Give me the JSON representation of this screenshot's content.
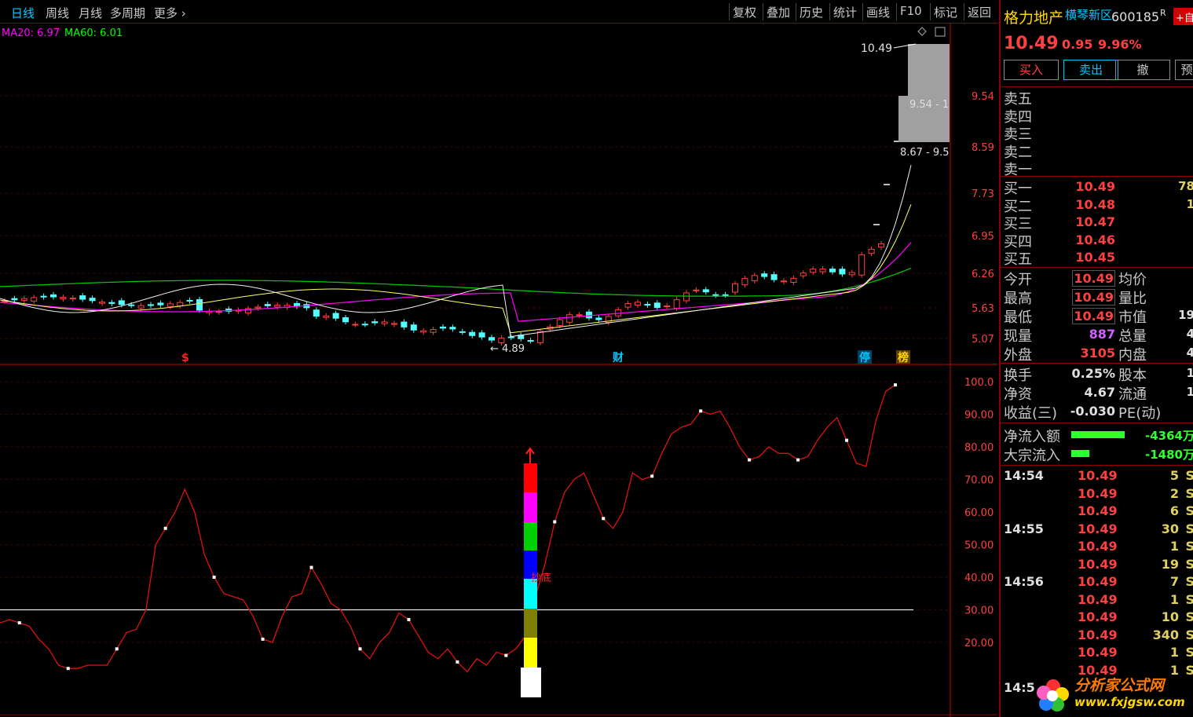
{
  "toolbar": {
    "periods": [
      "日线",
      "周线",
      "月线",
      "多周期",
      "更多"
    ],
    "buttons": [
      "复权",
      "叠加",
      "历史",
      "统计",
      "画线",
      "F10",
      "标记",
      "返回"
    ]
  },
  "main_chart": {
    "ma_legend": [
      {
        "label": "MA20: 6.97",
        "color": "#ff00ff"
      },
      {
        "label": "MA60: 6.01",
        "color": "#00ff00"
      }
    ],
    "price_axis": [
      "9.54",
      "8.59",
      "7.73",
      "6.95",
      "6.26",
      "5.63",
      "5.07"
    ],
    "top_label": "10.49",
    "chip_labels": [
      "9.54 - 1",
      "8.67 - 9.5"
    ],
    "low_label": "4.89",
    "event_markers": [
      {
        "text": "$",
        "color": "#ff2020"
      },
      {
        "text": "财",
        "color": "#00c8ff"
      },
      {
        "text": "停",
        "color": "#00c8ff"
      },
      {
        "text": "榜",
        "color": "#ffd700"
      }
    ]
  },
  "indicator": {
    "axis": [
      "100.0",
      "90.00",
      "80.00",
      "70.00",
      "60.00",
      "50.00",
      "40.00",
      "30.00",
      "20.00"
    ],
    "signal_label": "抄底"
  },
  "chart_data": {
    "type": "line",
    "title": "",
    "xlabel": "",
    "ylabel": "",
    "ylim": [
      10,
      100
    ],
    "reference_line": 30,
    "series": [
      {
        "values": [
          26,
          27,
          26,
          25,
          21,
          18,
          13,
          12,
          12,
          13,
          13,
          13,
          18,
          23,
          24,
          30,
          50,
          55,
          60,
          67,
          60,
          47,
          40,
          35,
          34,
          33,
          28,
          21,
          20,
          28,
          34,
          35,
          43,
          38,
          32,
          30,
          25,
          18,
          15,
          20,
          23,
          29,
          27,
          22,
          17,
          15,
          18,
          14,
          11,
          15,
          13,
          17,
          16,
          18,
          22,
          34,
          44,
          57,
          66,
          70,
          72,
          65,
          58,
          55,
          60,
          72,
          70,
          71,
          78,
          84,
          86,
          87,
          91,
          90,
          91,
          86,
          80,
          76,
          77,
          80,
          78,
          78,
          76,
          77,
          82,
          86,
          89,
          82,
          75,
          74,
          88,
          97,
          99
        ]
      }
    ]
  },
  "quote": {
    "name": "格力地产",
    "tag": "横琴新区",
    "code": "600185",
    "r_mark": "R",
    "add_label": "+自",
    "price": "10.49",
    "change": "0.95",
    "change_pct": "9.96%",
    "buttons": [
      "买入",
      "卖出",
      "撤",
      "预"
    ],
    "sell_levels": [
      "卖五",
      "卖四",
      "卖三",
      "卖二",
      "卖一"
    ],
    "buy_levels": [
      {
        "label": "买一",
        "price": "10.49",
        "vol": "78"
      },
      {
        "label": "买二",
        "price": "10.48",
        "vol": "1"
      },
      {
        "label": "买三",
        "price": "10.47",
        "vol": ""
      },
      {
        "label": "买四",
        "price": "10.46",
        "vol": ""
      },
      {
        "label": "买五",
        "price": "10.45",
        "vol": ""
      }
    ],
    "stats1": [
      {
        "k1": "今开",
        "v1": "10.49",
        "k2": "均价",
        "v2": ""
      },
      {
        "k1": "最高",
        "v1": "10.49",
        "k2": "量比",
        "v2": ""
      },
      {
        "k1": "最低",
        "v1": "10.49",
        "k2": "市值",
        "v2": "19"
      },
      {
        "k1": "现量",
        "v1": "887",
        "k2": "总量",
        "v2": "4"
      },
      {
        "k1": "外盘",
        "v1": "3105",
        "k2": "内盘",
        "v2": "4"
      }
    ],
    "stats2": [
      {
        "k1": "换手",
        "v1": "0.25%",
        "k2": "股本",
        "v2": "1"
      },
      {
        "k1": "净资",
        "v1": "4.67",
        "k2": "流通",
        "v2": "1"
      },
      {
        "k1": "收益(三)",
        "v1": "-0.030",
        "k2": "PE(动)",
        "v2": ""
      }
    ],
    "flows": [
      {
        "label": "净流入额",
        "value": "-4364万",
        "fill": 0.45
      },
      {
        "label": "大宗流入",
        "value": "-1480万",
        "fill": 0.15
      }
    ],
    "ticks": [
      {
        "time": "14:54",
        "price": "10.49",
        "qty": "5",
        "side": "S"
      },
      {
        "time": "",
        "price": "10.49",
        "qty": "2",
        "side": "S"
      },
      {
        "time": "",
        "price": "10.49",
        "qty": "6",
        "side": "S"
      },
      {
        "time": "14:55",
        "price": "10.49",
        "qty": "30",
        "side": "S"
      },
      {
        "time": "",
        "price": "10.49",
        "qty": "1",
        "side": "S"
      },
      {
        "time": "",
        "price": "10.49",
        "qty": "19",
        "side": "S"
      },
      {
        "time": "14:56",
        "price": "10.49",
        "qty": "7",
        "side": "S"
      },
      {
        "time": "",
        "price": "10.49",
        "qty": "1",
        "side": "S"
      },
      {
        "time": "",
        "price": "10.49",
        "qty": "10",
        "side": "S"
      },
      {
        "time": "",
        "price": "10.49",
        "qty": "340",
        "side": "S"
      },
      {
        "time": "",
        "price": "10.49",
        "qty": "1",
        "side": "S"
      },
      {
        "time": "",
        "price": "10.49",
        "qty": "1",
        "side": "S"
      },
      {
        "time": "14:5",
        "price": "",
        "qty": "",
        "side": ""
      }
    ],
    "watermark": {
      "text": "分析家公式网",
      "url": "www.fxjgsw.com"
    }
  },
  "colors": {
    "up": "#ff4040",
    "down": "#54ffff",
    "axis": "#8b0000",
    "grid": "#5a0000"
  }
}
